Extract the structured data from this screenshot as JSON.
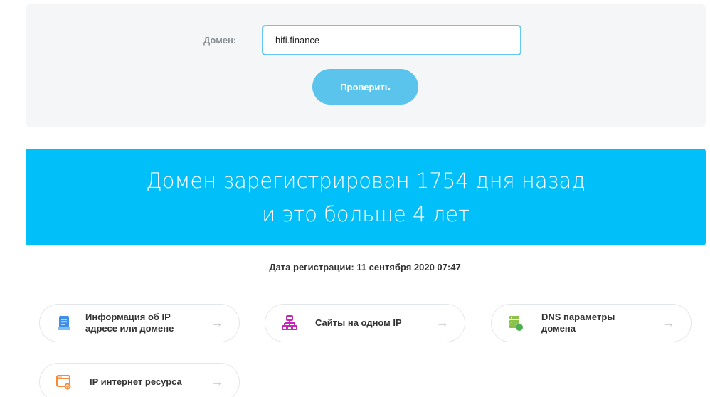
{
  "form": {
    "domain_label": "Домен:",
    "domain_value": "hifi.finance",
    "check_button": "Проверить"
  },
  "result": {
    "line1": "Домен зарегистрирован 1754 дня назад",
    "line2": "и это больше 4 лет"
  },
  "registration": {
    "text": "Дата регистрации: 11 сентября 2020 07:47"
  },
  "links": [
    {
      "label": "Информация об IP адресе или домене",
      "icon": "document-icon",
      "arrow": "→"
    },
    {
      "label": "Сайты на одном IP",
      "icon": "network-icon",
      "arrow": "→"
    },
    {
      "label": "DNS параметры домена",
      "icon": "dns-server-icon",
      "arrow": "→"
    },
    {
      "label": "IP интернет ресурса",
      "icon": "web-resource-icon",
      "arrow": "→"
    }
  ],
  "colors": {
    "accent": "#00bff9",
    "button": "#5bc4ec",
    "input_border": "#66c8ee",
    "panel_bg": "#f4f6f7"
  }
}
